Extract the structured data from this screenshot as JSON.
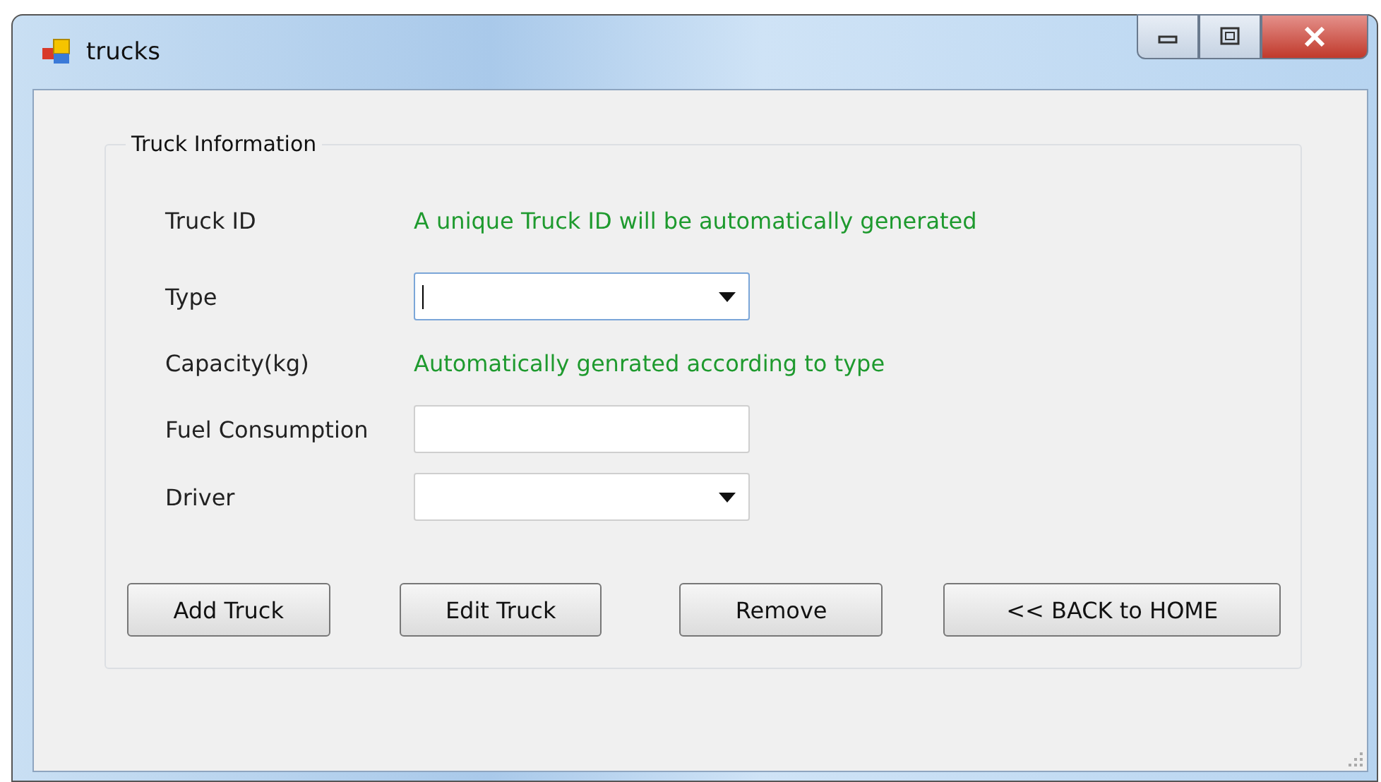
{
  "window": {
    "title": "trucks"
  },
  "group": {
    "title": "Truck Information"
  },
  "fields": [
    {
      "label": "Truck ID",
      "kind": "note",
      "text": "A unique Truck ID will be automatically generated"
    },
    {
      "label": "Type",
      "kind": "combo",
      "focused": true
    },
    {
      "label": "Capacity(kg)",
      "kind": "note",
      "text": "Automatically genrated according to type"
    },
    {
      "label": "Fuel Consumption",
      "kind": "text",
      "focused": false
    },
    {
      "label": "Driver",
      "kind": "combo",
      "focused": false
    }
  ],
  "buttons": [
    "Add Truck",
    "Edit Truck",
    "Remove",
    "<< BACK to HOME"
  ]
}
